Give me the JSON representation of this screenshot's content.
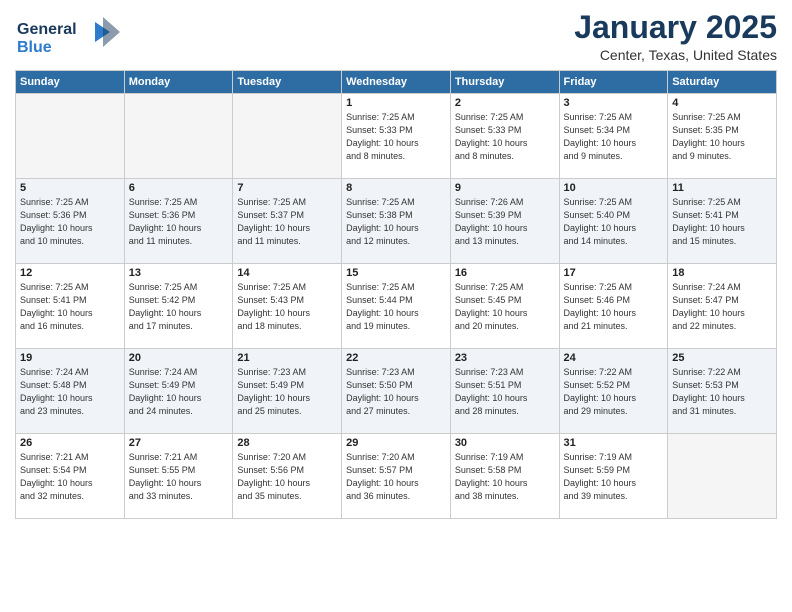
{
  "header": {
    "logo_line1": "General",
    "logo_line2": "Blue",
    "title": "January 2025",
    "subtitle": "Center, Texas, United States"
  },
  "days_of_week": [
    "Sunday",
    "Monday",
    "Tuesday",
    "Wednesday",
    "Thursday",
    "Friday",
    "Saturday"
  ],
  "weeks": [
    [
      {
        "day": "",
        "info": ""
      },
      {
        "day": "",
        "info": ""
      },
      {
        "day": "",
        "info": ""
      },
      {
        "day": "1",
        "info": "Sunrise: 7:25 AM\nSunset: 5:33 PM\nDaylight: 10 hours\nand 8 minutes."
      },
      {
        "day": "2",
        "info": "Sunrise: 7:25 AM\nSunset: 5:33 PM\nDaylight: 10 hours\nand 8 minutes."
      },
      {
        "day": "3",
        "info": "Sunrise: 7:25 AM\nSunset: 5:34 PM\nDaylight: 10 hours\nand 9 minutes."
      },
      {
        "day": "4",
        "info": "Sunrise: 7:25 AM\nSunset: 5:35 PM\nDaylight: 10 hours\nand 9 minutes."
      }
    ],
    [
      {
        "day": "5",
        "info": "Sunrise: 7:25 AM\nSunset: 5:36 PM\nDaylight: 10 hours\nand 10 minutes."
      },
      {
        "day": "6",
        "info": "Sunrise: 7:25 AM\nSunset: 5:36 PM\nDaylight: 10 hours\nand 11 minutes."
      },
      {
        "day": "7",
        "info": "Sunrise: 7:25 AM\nSunset: 5:37 PM\nDaylight: 10 hours\nand 11 minutes."
      },
      {
        "day": "8",
        "info": "Sunrise: 7:25 AM\nSunset: 5:38 PM\nDaylight: 10 hours\nand 12 minutes."
      },
      {
        "day": "9",
        "info": "Sunrise: 7:26 AM\nSunset: 5:39 PM\nDaylight: 10 hours\nand 13 minutes."
      },
      {
        "day": "10",
        "info": "Sunrise: 7:25 AM\nSunset: 5:40 PM\nDaylight: 10 hours\nand 14 minutes."
      },
      {
        "day": "11",
        "info": "Sunrise: 7:25 AM\nSunset: 5:41 PM\nDaylight: 10 hours\nand 15 minutes."
      }
    ],
    [
      {
        "day": "12",
        "info": "Sunrise: 7:25 AM\nSunset: 5:41 PM\nDaylight: 10 hours\nand 16 minutes."
      },
      {
        "day": "13",
        "info": "Sunrise: 7:25 AM\nSunset: 5:42 PM\nDaylight: 10 hours\nand 17 minutes."
      },
      {
        "day": "14",
        "info": "Sunrise: 7:25 AM\nSunset: 5:43 PM\nDaylight: 10 hours\nand 18 minutes."
      },
      {
        "day": "15",
        "info": "Sunrise: 7:25 AM\nSunset: 5:44 PM\nDaylight: 10 hours\nand 19 minutes."
      },
      {
        "day": "16",
        "info": "Sunrise: 7:25 AM\nSunset: 5:45 PM\nDaylight: 10 hours\nand 20 minutes."
      },
      {
        "day": "17",
        "info": "Sunrise: 7:25 AM\nSunset: 5:46 PM\nDaylight: 10 hours\nand 21 minutes."
      },
      {
        "day": "18",
        "info": "Sunrise: 7:24 AM\nSunset: 5:47 PM\nDaylight: 10 hours\nand 22 minutes."
      }
    ],
    [
      {
        "day": "19",
        "info": "Sunrise: 7:24 AM\nSunset: 5:48 PM\nDaylight: 10 hours\nand 23 minutes."
      },
      {
        "day": "20",
        "info": "Sunrise: 7:24 AM\nSunset: 5:49 PM\nDaylight: 10 hours\nand 24 minutes."
      },
      {
        "day": "21",
        "info": "Sunrise: 7:23 AM\nSunset: 5:49 PM\nDaylight: 10 hours\nand 25 minutes."
      },
      {
        "day": "22",
        "info": "Sunrise: 7:23 AM\nSunset: 5:50 PM\nDaylight: 10 hours\nand 27 minutes."
      },
      {
        "day": "23",
        "info": "Sunrise: 7:23 AM\nSunset: 5:51 PM\nDaylight: 10 hours\nand 28 minutes."
      },
      {
        "day": "24",
        "info": "Sunrise: 7:22 AM\nSunset: 5:52 PM\nDaylight: 10 hours\nand 29 minutes."
      },
      {
        "day": "25",
        "info": "Sunrise: 7:22 AM\nSunset: 5:53 PM\nDaylight: 10 hours\nand 31 minutes."
      }
    ],
    [
      {
        "day": "26",
        "info": "Sunrise: 7:21 AM\nSunset: 5:54 PM\nDaylight: 10 hours\nand 32 minutes."
      },
      {
        "day": "27",
        "info": "Sunrise: 7:21 AM\nSunset: 5:55 PM\nDaylight: 10 hours\nand 33 minutes."
      },
      {
        "day": "28",
        "info": "Sunrise: 7:20 AM\nSunset: 5:56 PM\nDaylight: 10 hours\nand 35 minutes."
      },
      {
        "day": "29",
        "info": "Sunrise: 7:20 AM\nSunset: 5:57 PM\nDaylight: 10 hours\nand 36 minutes."
      },
      {
        "day": "30",
        "info": "Sunrise: 7:19 AM\nSunset: 5:58 PM\nDaylight: 10 hours\nand 38 minutes."
      },
      {
        "day": "31",
        "info": "Sunrise: 7:19 AM\nSunset: 5:59 PM\nDaylight: 10 hours\nand 39 minutes."
      },
      {
        "day": "",
        "info": ""
      }
    ]
  ]
}
